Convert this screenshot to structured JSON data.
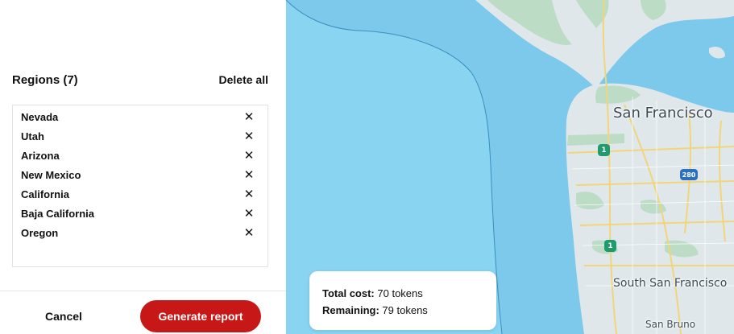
{
  "regions": {
    "title": "Regions (7)",
    "delete_all_label": "Delete all",
    "items": [
      {
        "name": "Nevada"
      },
      {
        "name": "Utah"
      },
      {
        "name": "Arizona"
      },
      {
        "name": "New Mexico"
      },
      {
        "name": "California"
      },
      {
        "name": "Baja California"
      },
      {
        "name": "Oregon"
      }
    ],
    "remove_icon": "close-icon",
    "remove_glyph": "✕"
  },
  "footer": {
    "cancel_label": "Cancel",
    "generate_label": "Generate report"
  },
  "map": {
    "labels": {
      "san_francisco": "San Francisco",
      "south_san_francisco": "South San Francisco",
      "san_bruno": "San Bruno"
    },
    "shields": {
      "route_1_a": "1",
      "route_1_b": "1",
      "route_280": "280"
    }
  },
  "cost": {
    "total_label": "Total cost:",
    "total_value": "70 tokens",
    "remaining_label": "Remaining:",
    "remaining_value": "79 tokens"
  },
  "colors": {
    "brand_red": "#c81717",
    "water": "#78c7ea",
    "water_light": "#86d3f0",
    "land": "#dde6ea",
    "park": "#b7d9c2",
    "road": "#f2d97a"
  }
}
